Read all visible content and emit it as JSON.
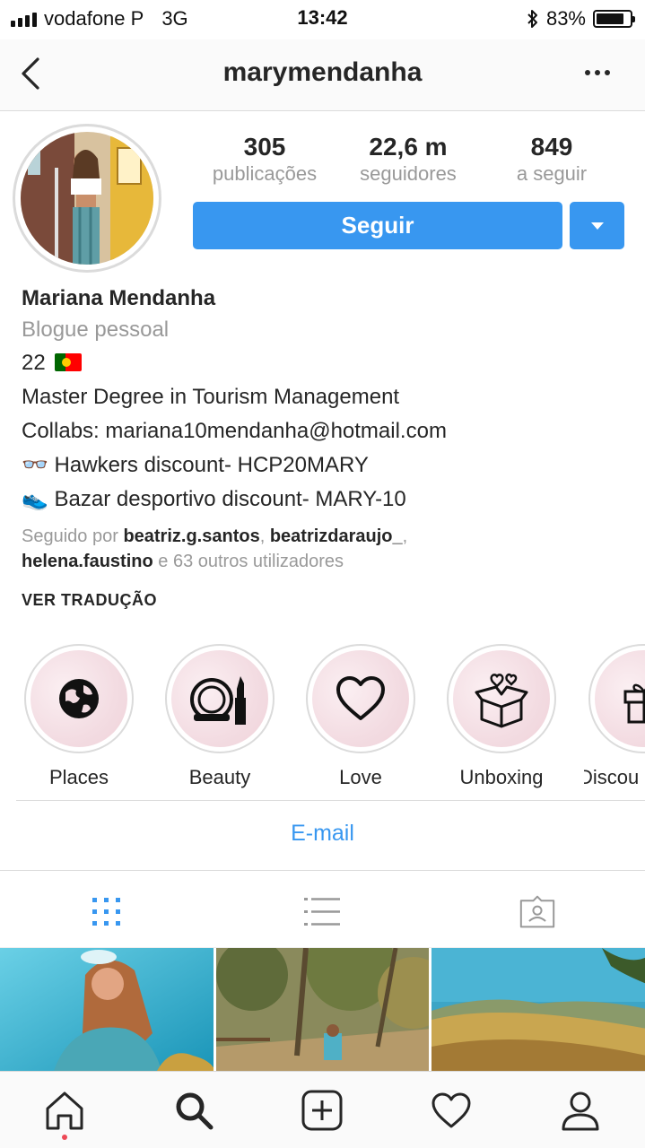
{
  "status_bar": {
    "carrier": "vodafone P",
    "network": "3G",
    "time": "13:42",
    "battery": "83%",
    "battery_level": 0.83
  },
  "header": {
    "title": "marymendanha",
    "back_icon": "chevron-left-icon",
    "more_icon": "more-horizontal-icon"
  },
  "profile": {
    "stats": [
      {
        "value": "305",
        "label": "publicações"
      },
      {
        "value": "22,6 m",
        "label": "seguidores"
      },
      {
        "value": "849",
        "label": "a seguir"
      }
    ],
    "follow_label": "Seguir"
  },
  "bio": {
    "name": "Mariana Mendanha",
    "category": "Blogue pessoal",
    "age": "22",
    "line1": "Master Degree in Tourism Management",
    "line2": "Collabs: mariana10mendanha@hotmail.com",
    "line3": "👓 Hawkers discount- HCP20MARY",
    "line4": "👟 Bazar desportivo discount- MARY-10"
  },
  "followed_by": {
    "prefix": "Seguido por",
    "user1": "beatriz.g.santos",
    "user2": "beatrizdaraujo_",
    "user3": "helena.faustino",
    "suffix": "e 63 outros utilizadores"
  },
  "translate_label": "VER TRADUÇÃO",
  "highlights": [
    {
      "label": "Places",
      "icon": "globe-icon"
    },
    {
      "label": "Beauty",
      "icon": "makeup-icon"
    },
    {
      "label": "Love",
      "icon": "heart-icon"
    },
    {
      "label": "Unboxing",
      "icon": "gift-box-icon"
    },
    {
      "label": "Discou",
      "icon": "gift-icon"
    }
  ],
  "email_label": "E-mail",
  "colors": {
    "accent": "#3897f0",
    "text": "#262626",
    "muted": "#999999",
    "notification": "#ed4956"
  }
}
